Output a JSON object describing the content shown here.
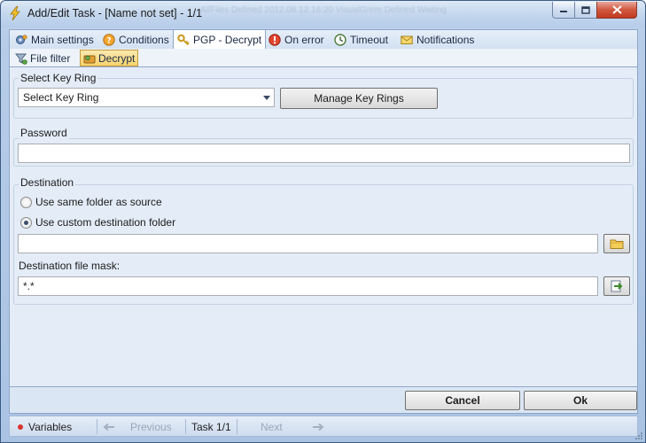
{
  "window": {
    "title": "Add/Edit Task - [Name not set] - 1/1",
    "ghost_text": "AllFiles Defined 2012.08.12.16:20 VisualGrem Defined Waiting"
  },
  "tabs": [
    {
      "label": "Main settings",
      "icon": "gear-icon",
      "active": false
    },
    {
      "label": "Conditions",
      "icon": "question-icon",
      "active": false
    },
    {
      "label": "PGP - Decrypt",
      "icon": "key-icon",
      "active": true
    },
    {
      "label": "On error",
      "icon": "error-icon",
      "active": false
    },
    {
      "label": "Timeout",
      "icon": "clock-icon",
      "active": false
    },
    {
      "label": "Notifications",
      "icon": "envelope-icon",
      "active": false
    }
  ],
  "subtabs": [
    {
      "label": "File filter",
      "icon": "filter-icon",
      "active": false
    },
    {
      "label": "Decrypt",
      "icon": "decrypt-icon",
      "active": true
    }
  ],
  "key_ring": {
    "group_title": "Select Key Ring",
    "combo_value": "Select Key Ring",
    "manage_button": "Manage Key Rings"
  },
  "password": {
    "group_title": "Password",
    "value": ""
  },
  "destination": {
    "group_title": "Destination",
    "option_same": "Use same folder as source",
    "option_custom": "Use custom destination folder",
    "selected": "custom",
    "folder_value": "",
    "mask_label": "Destination file mask:",
    "mask_value": "*.*"
  },
  "buttons": {
    "cancel": "Cancel",
    "ok": "Ok"
  },
  "statusbar": {
    "variables": "Variables",
    "previous": "Previous",
    "task": "Task 1/1",
    "next": "Next"
  },
  "colors": {
    "frame": "#b7cde8",
    "panel": "#e4ecf7",
    "active_subtab": "#f6d46f",
    "variables_dot": "#d9342b"
  }
}
